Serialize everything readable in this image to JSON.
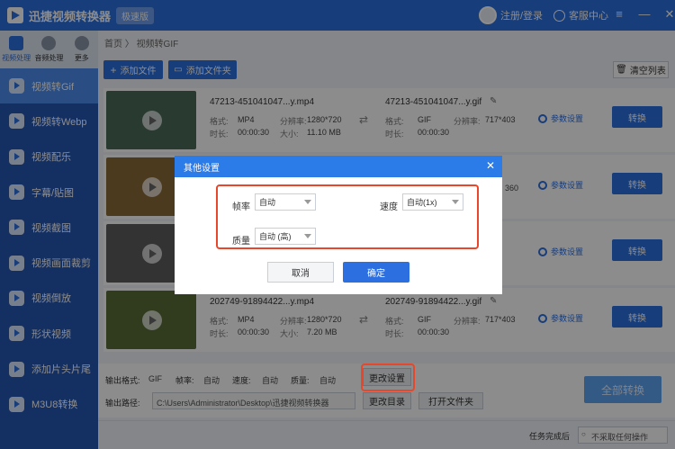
{
  "app": {
    "title": "迅捷视频转换器",
    "badge": "极速版",
    "login": "注册/登录",
    "help": "客服中心",
    "window_controls": [
      "≡",
      "—",
      "✕"
    ]
  },
  "top_tabs": [
    {
      "label": "视频处理"
    },
    {
      "label": "音频处理"
    },
    {
      "label": "更多"
    }
  ],
  "nav": [
    {
      "label": "视频转Gif"
    },
    {
      "label": "视频转Webp"
    },
    {
      "label": "视频配乐"
    },
    {
      "label": "字幕/贴图"
    },
    {
      "label": "视频截图"
    },
    {
      "label": "视频画面裁剪"
    },
    {
      "label": "视频倒放"
    },
    {
      "label": "形状视频"
    },
    {
      "label": "添加片头片尾"
    },
    {
      "label": "M3U8转换"
    }
  ],
  "breadcrumb": {
    "home": "首页",
    "sep": "〉",
    "current": "视频转GIF"
  },
  "actions": {
    "add_file": "添加文件",
    "add_folder": "添加文件夹",
    "clear_list": "清空列表"
  },
  "row_labels": {
    "format": "格式:",
    "duration": "时长:",
    "resolution": "分辨率:",
    "size": "大小:",
    "params": "参数设置",
    "convert": "转换"
  },
  "files": [
    {
      "src_name": "47213-451041047...y.mp4",
      "src_format": "MP4",
      "src_duration": "00:00:30",
      "src_resolution": "1280*720",
      "src_size": "11.10 MB",
      "out_name": "47213-451041047...y.gif",
      "out_format": "GIF",
      "out_duration": "00:00:30",
      "out_resolution": "717*403",
      "thumb_color": "#4c6a5a"
    },
    {
      "src_name": "",
      "src_format": "",
      "src_duration": "",
      "src_resolution": "",
      "src_size": "",
      "out_name": "",
      "out_format": "",
      "out_duration": "",
      "out_resolution": "360",
      "thumb_color": "#8a6a3a"
    },
    {
      "src_name": "",
      "src_format": "",
      "src_duration": "",
      "src_resolution": "",
      "src_size": "",
      "out_name": "",
      "out_format": "",
      "out_duration": "",
      "out_resolution": "",
      "thumb_color": "#5e5e5e"
    },
    {
      "src_name": "202749-91894422...y.mp4",
      "src_format": "MP4",
      "src_duration": "00:00:30",
      "src_resolution": "1280*720",
      "src_size": "7.20 MB",
      "out_name": "202749-91894422...y.gif",
      "out_format": "GIF",
      "out_duration": "00:00:30",
      "out_resolution": "717*403",
      "thumb_color": "#5a6e3a"
    }
  ],
  "output": {
    "format_label": "输出格式:",
    "format_value": "GIF",
    "fps_label": "帧率:",
    "fps_value": "自动",
    "speed_label": "速度:",
    "speed_value": "自动",
    "quality_label": "质量:",
    "quality_value": "自动",
    "change_settings": "更改设置",
    "path_label": "输出路径:",
    "path_value": "C:\\Users\\Administrator\\Desktop\\迅捷视频转换器",
    "change_dir": "更改目录",
    "open_folder": "打开文件夹",
    "convert_all": "全部转换"
  },
  "status": {
    "task_done_label": "任务完成后",
    "task_done_value": "不采取任何操作"
  },
  "dialog": {
    "title": "其他设置",
    "fps_label": "帧率",
    "fps_value": "自动",
    "speed_label": "速度",
    "speed_value": "自动(1x)",
    "quality_label": "质量",
    "quality_value": "自动 (高)",
    "cancel": "取消",
    "ok": "确定"
  },
  "colors": {
    "primary": "#2b6fe0",
    "sidebar": "#2557b3",
    "sidebar_active": "#4d8ff0",
    "highlight": "#e8472c"
  }
}
